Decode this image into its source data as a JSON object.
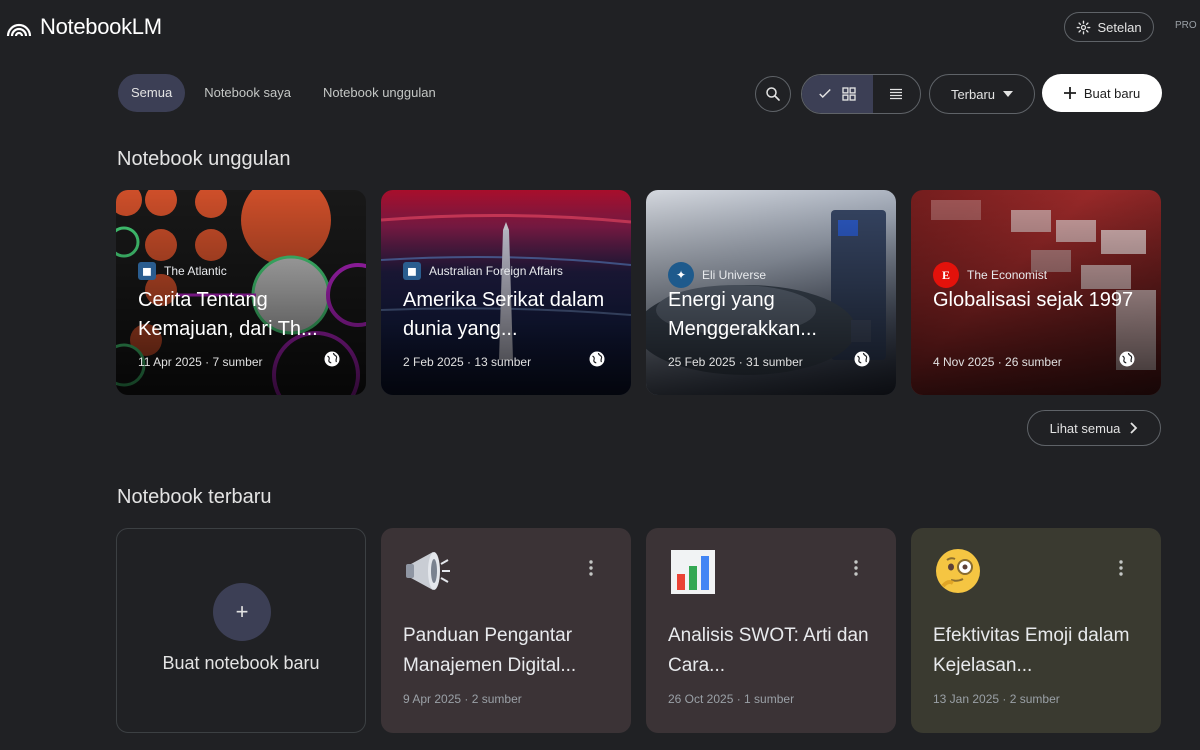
{
  "app": {
    "name": "NotebookLM",
    "pro_tag": "PRO"
  },
  "header": {
    "settings_label": "Setelan"
  },
  "filters": [
    {
      "label": "Semua",
      "active": true
    },
    {
      "label": "Notebook saya",
      "active": false
    },
    {
      "label": "Notebook unggulan",
      "active": false
    }
  ],
  "toolbar": {
    "search_icon": "search-icon",
    "view_mode": "grid",
    "sort_label": "Terbaru",
    "create_label": "Buat baru"
  },
  "featured": {
    "title": "Notebook unggulan",
    "see_all_label": "Lihat semua",
    "items": [
      {
        "source": "The Atlantic",
        "title": "Cerita Tentang Kemajuan, dari Th...",
        "meta": "11 Apr 2025 · 7 sumber"
      },
      {
        "source": "Australian Foreign Affairs",
        "title": "Amerika Serikat dalam dunia yang...",
        "meta": "2 Feb 2025 · 13 sumber"
      },
      {
        "source": "Eli Universe",
        "title": "Energi yang Menggerakkan...",
        "meta": "25 Feb 2025 · 31 sumber"
      },
      {
        "source": "The Economist",
        "title": "Globalisasi sejak 1997",
        "meta": "4 Nov 2025 · 26 sumber"
      }
    ]
  },
  "recent": {
    "title": "Notebook terbaru",
    "new_label": "Buat notebook baru",
    "new_plus": "+",
    "items": [
      {
        "emoji": "megaphone-icon",
        "title": "Panduan Pengantar Manajemen Digital...",
        "meta": "9 Apr 2025 · 2 sumber",
        "bg": "#3b3336"
      },
      {
        "emoji": "bar-chart-icon",
        "title": "Analisis SWOT: Arti dan Cara...",
        "meta": "26 Oct 2025 · 1 sumber",
        "bg": "#3b3336"
      },
      {
        "emoji": "thinking-face-icon",
        "title": "Efektivitas Emoji dalam Kejelasan...",
        "meta": "13 Jan 2025 · 2 sumber",
        "bg": "#3a3a30"
      }
    ]
  }
}
